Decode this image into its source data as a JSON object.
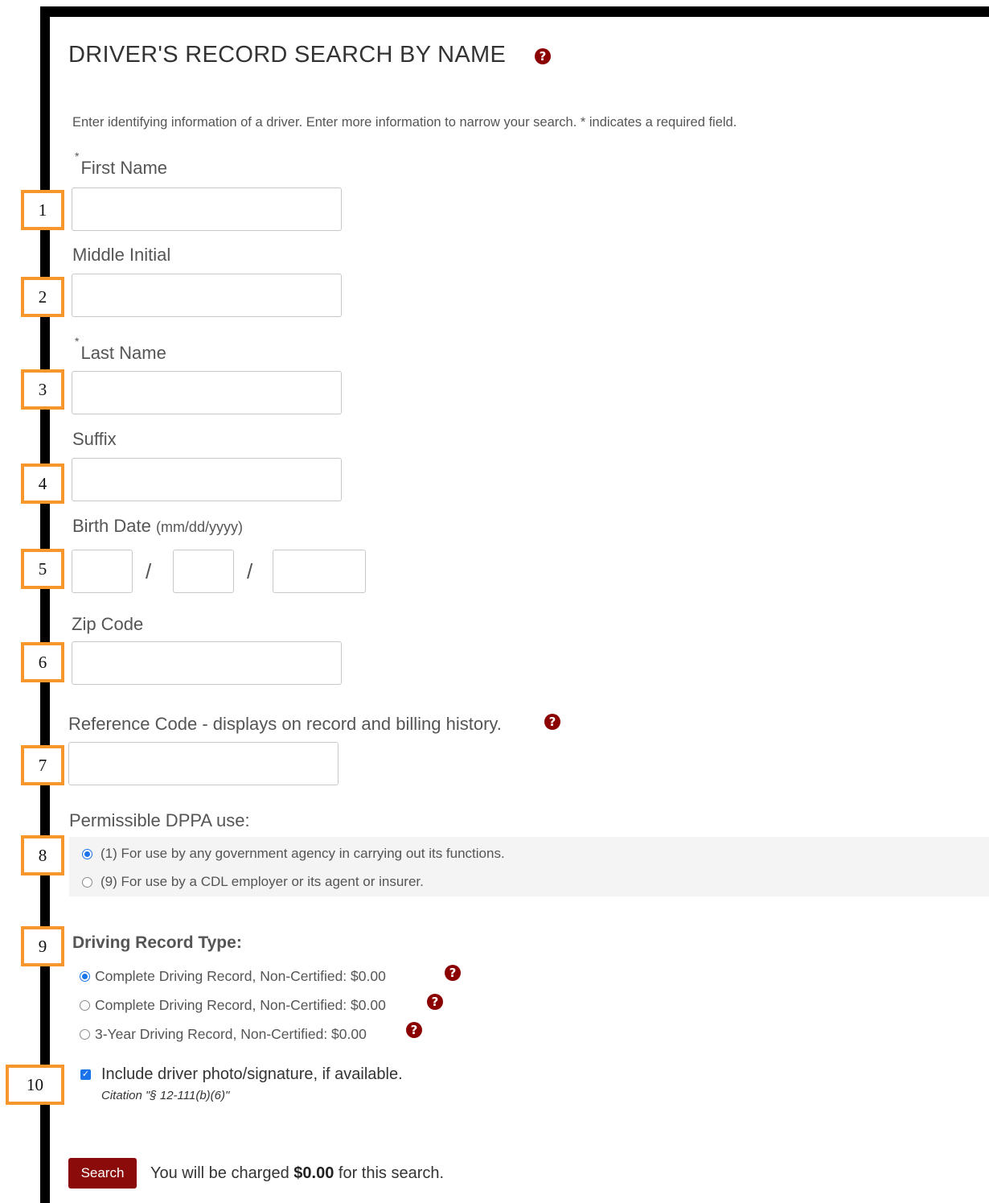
{
  "page": {
    "title": "DRIVER'S RECORD SEARCH BY NAME",
    "help_glyph": "?",
    "instructions": "Enter identifying information of a driver. Enter more information to narrow your search. * indicates a required field."
  },
  "colors": {
    "accent": "#8b0a0a",
    "marker_border": "#f7962d",
    "selected": "#1a73e8"
  },
  "fields": {
    "required_mark": "*",
    "first_name": {
      "label": "First Name",
      "value": "",
      "marker": "1"
    },
    "middle_initial": {
      "label": "Middle Initial",
      "value": "",
      "marker": "2"
    },
    "last_name": {
      "label": "Last Name",
      "value": "",
      "marker": "3"
    },
    "suffix": {
      "label": "Suffix",
      "value": "",
      "marker": "4"
    },
    "birth_date": {
      "label": "Birth Date",
      "hint": "(mm/dd/yyyy)",
      "separator": "/",
      "month": "",
      "day": "",
      "year": "",
      "marker": "5"
    },
    "zip_code": {
      "label": "Zip Code",
      "value": "",
      "marker": "6"
    },
    "reference_code": {
      "label": "Reference Code - displays on record and billing history.",
      "value": "",
      "marker": "7"
    }
  },
  "dppa": {
    "label": "Permissible DPPA use:",
    "marker": "8",
    "options": [
      {
        "label": "(1) For use by any government agency in carrying out its functions.",
        "selected": true
      },
      {
        "label": "(9) For use by a CDL employer or its agent or insurer.",
        "selected": false
      }
    ]
  },
  "record_type": {
    "label": "Driving Record Type:",
    "marker": "9",
    "options": [
      {
        "label": "Complete Driving Record, Non-Certified: $0.00",
        "selected": true
      },
      {
        "label": "Complete Driving Record, Non-Certified: $0.00",
        "selected": false
      },
      {
        "label": "3-Year Driving Record, Non-Certified: $0.00",
        "selected": false
      }
    ]
  },
  "photo": {
    "label": "Include driver photo/signature, if available.",
    "checked": true,
    "citation": "Citation \"§ 12-111(b)(6)\"",
    "marker": "10"
  },
  "footer": {
    "search_label": "Search",
    "charge_prefix": "You will be charged",
    "charge_amount": "$0.00",
    "charge_suffix": "for this search."
  }
}
